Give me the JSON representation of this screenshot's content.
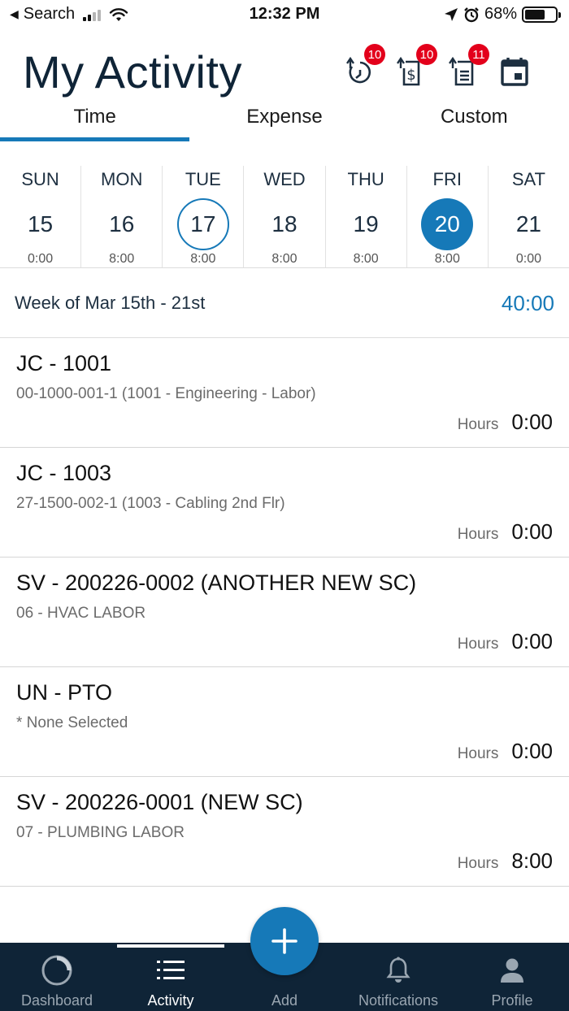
{
  "status_bar": {
    "back_label": "Search",
    "time": "12:32 PM",
    "battery": "68%",
    "battery_level": 0.68
  },
  "header": {
    "title": "My Activity",
    "actions": [
      {
        "icon": "time-submit-icon",
        "badge": "10"
      },
      {
        "icon": "expense-submit-icon",
        "badge": "10"
      },
      {
        "icon": "custom-submit-icon",
        "badge": "11"
      },
      {
        "icon": "calendar-icon",
        "badge": ""
      }
    ]
  },
  "tabs": [
    {
      "label": "Time",
      "active": true
    },
    {
      "label": "Expense",
      "active": false
    },
    {
      "label": "Custom",
      "active": false
    }
  ],
  "week": {
    "days": [
      {
        "name": "SUN",
        "num": "15",
        "hours": "0:00",
        "state": ""
      },
      {
        "name": "MON",
        "num": "16",
        "hours": "8:00",
        "state": ""
      },
      {
        "name": "TUE",
        "num": "17",
        "hours": "8:00",
        "state": "today"
      },
      {
        "name": "WED",
        "num": "18",
        "hours": "8:00",
        "state": ""
      },
      {
        "name": "THU",
        "num": "19",
        "hours": "8:00",
        "state": ""
      },
      {
        "name": "FRI",
        "num": "20",
        "hours": "8:00",
        "state": "selected"
      },
      {
        "name": "SAT",
        "num": "21",
        "hours": "0:00",
        "state": ""
      }
    ],
    "label": "Week of Mar 15th - 21st",
    "total": "40:00"
  },
  "entries": [
    {
      "title": "JC - 1001",
      "subtitle": "00-1000-001-1 (1001 - Engineering - Labor)",
      "hours_label": "Hours",
      "hours": "0:00"
    },
    {
      "title": "JC - 1003",
      "subtitle": "27-1500-002-1 (1003 - Cabling 2nd Flr)",
      "hours_label": "Hours",
      "hours": "0:00"
    },
    {
      "title": "SV - 200226-0002 (ANOTHER NEW SC)",
      "subtitle": "06 - HVAC LABOR",
      "hours_label": "Hours",
      "hours": "0:00"
    },
    {
      "title": "UN - PTO",
      "subtitle": "* None Selected",
      "hours_label": "Hours",
      "hours": "0:00"
    },
    {
      "title": "SV - 200226-0001 (NEW SC)",
      "subtitle": "07 - PLUMBING LABOR",
      "hours_label": "Hours",
      "hours": "8:00"
    }
  ],
  "nav": {
    "items": [
      {
        "label": "Dashboard",
        "icon": "dashboard-icon",
        "active": false
      },
      {
        "label": "Activity",
        "icon": "list-icon",
        "active": true
      },
      {
        "label": "Add",
        "icon": "add-icon",
        "active": false
      },
      {
        "label": "Notifications",
        "icon": "bell-icon",
        "active": false
      },
      {
        "label": "Profile",
        "icon": "person-icon",
        "active": false
      }
    ]
  },
  "colors": {
    "accent": "#1679b8",
    "nav_bg": "#0f2437",
    "badge": "#e3001b"
  }
}
